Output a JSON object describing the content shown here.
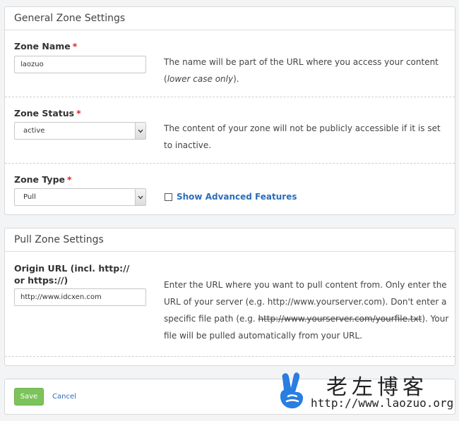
{
  "general": {
    "heading": "General Zone Settings",
    "zone_name": {
      "label": "Zone Name",
      "required": "*",
      "value": "laozuo",
      "help_prefix": "The name will be part of the URL where you access your content (",
      "help_italic": "lower case only",
      "help_suffix": ")."
    },
    "zone_status": {
      "label": "Zone Status",
      "required": "*",
      "selected": "active",
      "help": "The content of your zone will not be publicly accessible if it is set to inactive."
    },
    "zone_type": {
      "label": "Zone Type",
      "required": "*",
      "selected": "Pull",
      "advanced_label": "Show Advanced Features"
    }
  },
  "pull": {
    "heading": "Pull Zone Settings",
    "origin": {
      "label": "Origin URL (incl. http:// or https://)",
      "value": "http://www.idcxen.com",
      "help_prefix": "Enter the URL where you want to pull content from. Only enter the URL of your server (e.g. http://www.yourserver.com). Don't enter a specific file path (e.g. ",
      "help_strike": "http://www.yourserver.com/yourfile.txt",
      "help_suffix": "). Your file will be pulled automatically from your URL."
    }
  },
  "actions": {
    "save_label": "Save",
    "cancel_label": "Cancel"
  },
  "watermark": {
    "title": "老左博客",
    "url": "http://www.laozuo.org"
  },
  "colors": {
    "accent": "#2a6ebb",
    "save": "#7dc35b",
    "required": "#d9262b",
    "logo": "#2a7de1"
  }
}
